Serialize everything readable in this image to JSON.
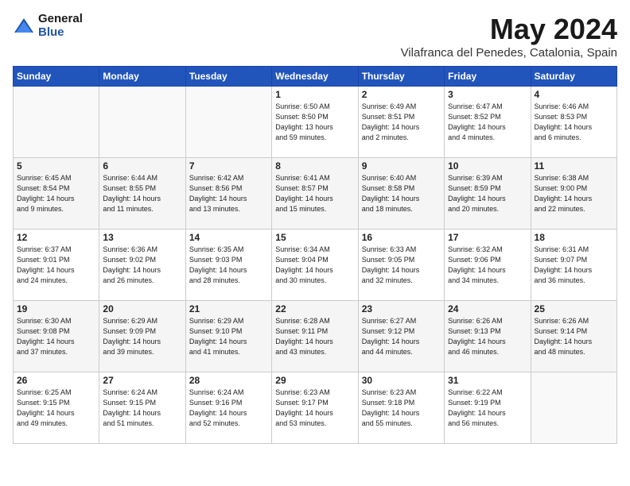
{
  "logo": {
    "general": "General",
    "blue": "Blue"
  },
  "title": "May 2024",
  "location": "Vilafranca del Penedes, Catalonia, Spain",
  "days_header": [
    "Sunday",
    "Monday",
    "Tuesday",
    "Wednesday",
    "Thursday",
    "Friday",
    "Saturday"
  ],
  "weeks": [
    [
      {
        "day": "",
        "info": ""
      },
      {
        "day": "",
        "info": ""
      },
      {
        "day": "",
        "info": ""
      },
      {
        "day": "1",
        "info": "Sunrise: 6:50 AM\nSunset: 8:50 PM\nDaylight: 13 hours\nand 59 minutes."
      },
      {
        "day": "2",
        "info": "Sunrise: 6:49 AM\nSunset: 8:51 PM\nDaylight: 14 hours\nand 2 minutes."
      },
      {
        "day": "3",
        "info": "Sunrise: 6:47 AM\nSunset: 8:52 PM\nDaylight: 14 hours\nand 4 minutes."
      },
      {
        "day": "4",
        "info": "Sunrise: 6:46 AM\nSunset: 8:53 PM\nDaylight: 14 hours\nand 6 minutes."
      }
    ],
    [
      {
        "day": "5",
        "info": "Sunrise: 6:45 AM\nSunset: 8:54 PM\nDaylight: 14 hours\nand 9 minutes."
      },
      {
        "day": "6",
        "info": "Sunrise: 6:44 AM\nSunset: 8:55 PM\nDaylight: 14 hours\nand 11 minutes."
      },
      {
        "day": "7",
        "info": "Sunrise: 6:42 AM\nSunset: 8:56 PM\nDaylight: 14 hours\nand 13 minutes."
      },
      {
        "day": "8",
        "info": "Sunrise: 6:41 AM\nSunset: 8:57 PM\nDaylight: 14 hours\nand 15 minutes."
      },
      {
        "day": "9",
        "info": "Sunrise: 6:40 AM\nSunset: 8:58 PM\nDaylight: 14 hours\nand 18 minutes."
      },
      {
        "day": "10",
        "info": "Sunrise: 6:39 AM\nSunset: 8:59 PM\nDaylight: 14 hours\nand 20 minutes."
      },
      {
        "day": "11",
        "info": "Sunrise: 6:38 AM\nSunset: 9:00 PM\nDaylight: 14 hours\nand 22 minutes."
      }
    ],
    [
      {
        "day": "12",
        "info": "Sunrise: 6:37 AM\nSunset: 9:01 PM\nDaylight: 14 hours\nand 24 minutes."
      },
      {
        "day": "13",
        "info": "Sunrise: 6:36 AM\nSunset: 9:02 PM\nDaylight: 14 hours\nand 26 minutes."
      },
      {
        "day": "14",
        "info": "Sunrise: 6:35 AM\nSunset: 9:03 PM\nDaylight: 14 hours\nand 28 minutes."
      },
      {
        "day": "15",
        "info": "Sunrise: 6:34 AM\nSunset: 9:04 PM\nDaylight: 14 hours\nand 30 minutes."
      },
      {
        "day": "16",
        "info": "Sunrise: 6:33 AM\nSunset: 9:05 PM\nDaylight: 14 hours\nand 32 minutes."
      },
      {
        "day": "17",
        "info": "Sunrise: 6:32 AM\nSunset: 9:06 PM\nDaylight: 14 hours\nand 34 minutes."
      },
      {
        "day": "18",
        "info": "Sunrise: 6:31 AM\nSunset: 9:07 PM\nDaylight: 14 hours\nand 36 minutes."
      }
    ],
    [
      {
        "day": "19",
        "info": "Sunrise: 6:30 AM\nSunset: 9:08 PM\nDaylight: 14 hours\nand 37 minutes."
      },
      {
        "day": "20",
        "info": "Sunrise: 6:29 AM\nSunset: 9:09 PM\nDaylight: 14 hours\nand 39 minutes."
      },
      {
        "day": "21",
        "info": "Sunrise: 6:29 AM\nSunset: 9:10 PM\nDaylight: 14 hours\nand 41 minutes."
      },
      {
        "day": "22",
        "info": "Sunrise: 6:28 AM\nSunset: 9:11 PM\nDaylight: 14 hours\nand 43 minutes."
      },
      {
        "day": "23",
        "info": "Sunrise: 6:27 AM\nSunset: 9:12 PM\nDaylight: 14 hours\nand 44 minutes."
      },
      {
        "day": "24",
        "info": "Sunrise: 6:26 AM\nSunset: 9:13 PM\nDaylight: 14 hours\nand 46 minutes."
      },
      {
        "day": "25",
        "info": "Sunrise: 6:26 AM\nSunset: 9:14 PM\nDaylight: 14 hours\nand 48 minutes."
      }
    ],
    [
      {
        "day": "26",
        "info": "Sunrise: 6:25 AM\nSunset: 9:15 PM\nDaylight: 14 hours\nand 49 minutes."
      },
      {
        "day": "27",
        "info": "Sunrise: 6:24 AM\nSunset: 9:15 PM\nDaylight: 14 hours\nand 51 minutes."
      },
      {
        "day": "28",
        "info": "Sunrise: 6:24 AM\nSunset: 9:16 PM\nDaylight: 14 hours\nand 52 minutes."
      },
      {
        "day": "29",
        "info": "Sunrise: 6:23 AM\nSunset: 9:17 PM\nDaylight: 14 hours\nand 53 minutes."
      },
      {
        "day": "30",
        "info": "Sunrise: 6:23 AM\nSunset: 9:18 PM\nDaylight: 14 hours\nand 55 minutes."
      },
      {
        "day": "31",
        "info": "Sunrise: 6:22 AM\nSunset: 9:19 PM\nDaylight: 14 hours\nand 56 minutes."
      },
      {
        "day": "",
        "info": ""
      }
    ]
  ]
}
